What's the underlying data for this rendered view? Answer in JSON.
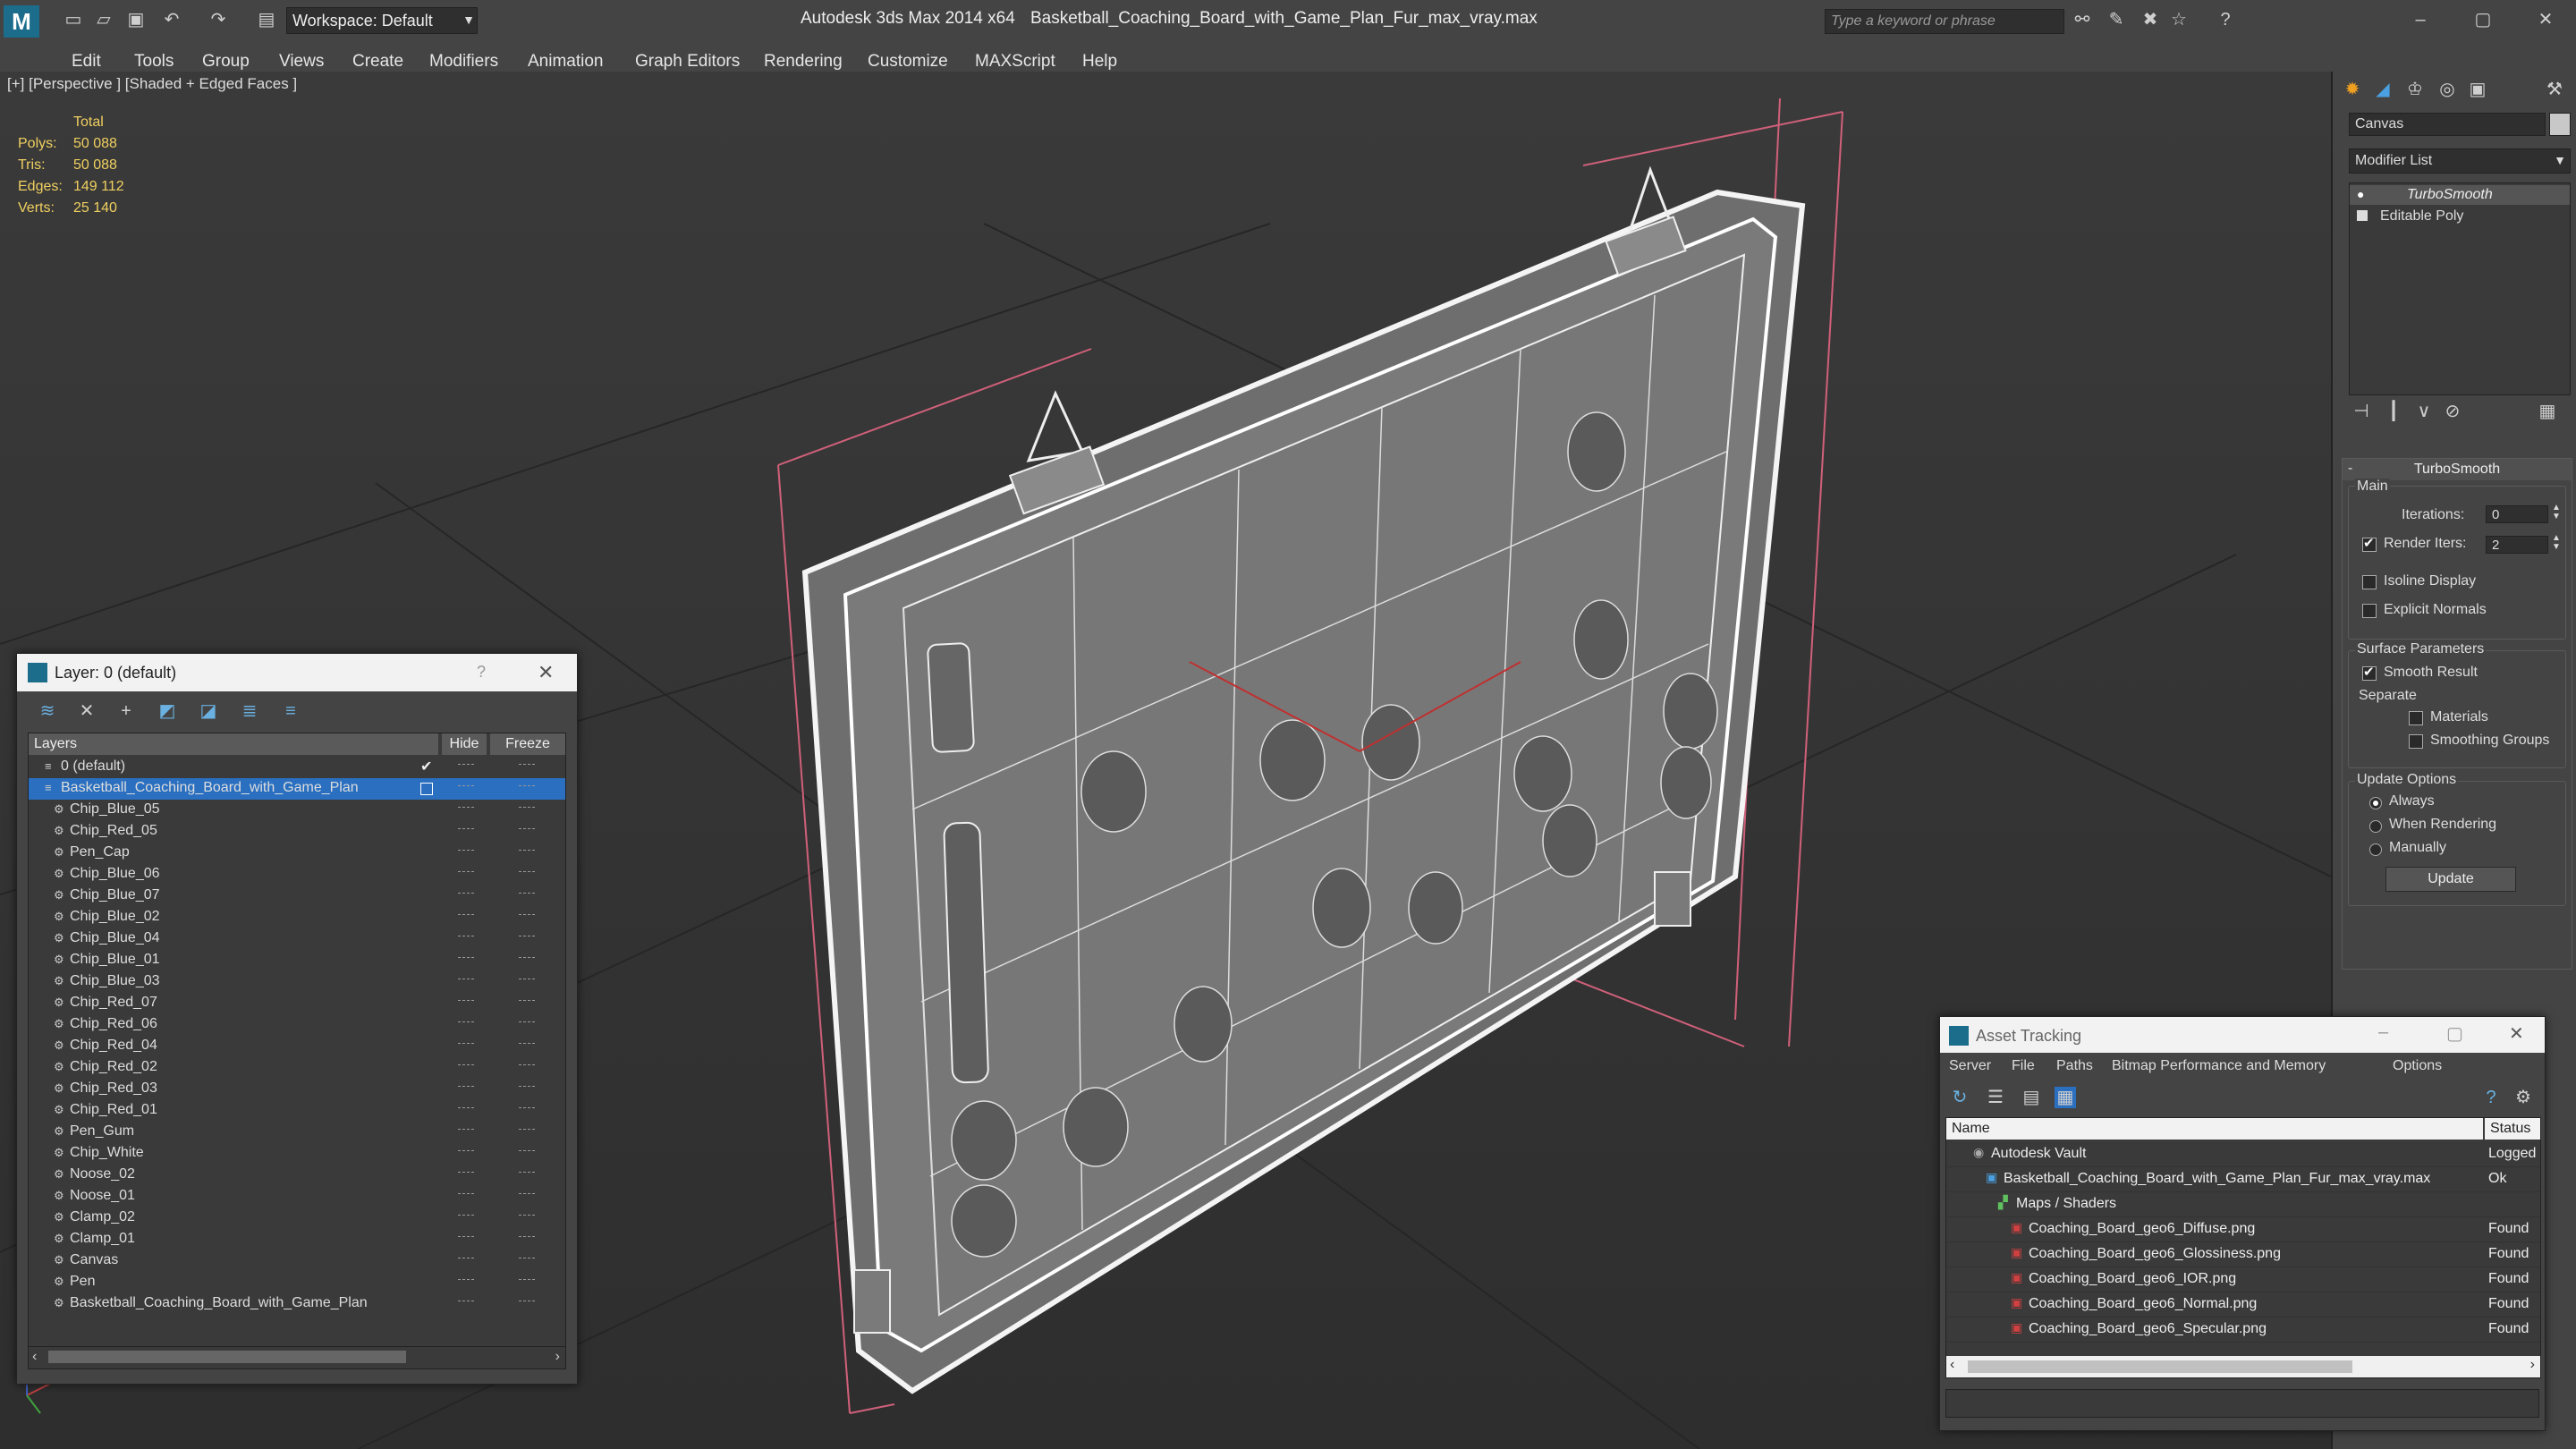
{
  "app": {
    "title": "Autodesk 3ds Max 2014 x64",
    "file": "Basketball_Coaching_Board_with_Game_Plan_Fur_max_vray.max",
    "workspace": "Workspace: Default",
    "search_placeholder": "Type a keyword or phrase"
  },
  "menu": [
    "Edit",
    "Tools",
    "Group",
    "Views",
    "Create",
    "Modifiers",
    "Animation",
    "Graph Editors",
    "Rendering",
    "Customize",
    "MAXScript",
    "Help"
  ],
  "viewport": {
    "label": "[+] [Perspective ] [Shaded + Edged Faces ]",
    "stats": {
      "header": "Total",
      "rows": [
        {
          "label": "Polys:",
          "value": "50 088"
        },
        {
          "label": "Tris:",
          "value": "50 088"
        },
        {
          "label": "Edges:",
          "value": "149 112"
        },
        {
          "label": "Verts:",
          "value": "25 140"
        }
      ]
    }
  },
  "right_panel": {
    "object_name": "Canvas",
    "modifier_list": "Modifier List",
    "stack": [
      "TurboSmooth",
      "Editable Poly"
    ],
    "rollout_title": "TurboSmooth",
    "main_group": "Main",
    "iterations_label": "Iterations:",
    "iterations_value": "0",
    "render_iters_label": "Render Iters:",
    "render_iters_value": "2",
    "isoline": "Isoline Display",
    "explicit": "Explicit Normals",
    "surface_group": "Surface Parameters",
    "smooth_result": "Smooth Result",
    "separate": "Separate",
    "materials": "Materials",
    "smoothing_groups": "Smoothing Groups",
    "update_group": "Update Options",
    "always": "Always",
    "when_rendering": "When Rendering",
    "manually": "Manually",
    "update_btn": "Update"
  },
  "layer_window": {
    "title": "Layer: 0 (default)",
    "help": "?",
    "col_layers": "Layers",
    "col_hide": "Hide",
    "col_freeze": "Freeze",
    "rows": [
      {
        "name": "0 (default)",
        "level": 1
      },
      {
        "name": "Basketball_Coaching_Board_with_Game_Plan",
        "level": 1,
        "selected": true
      },
      {
        "name": "Chip_Blue_05",
        "level": 2
      },
      {
        "name": "Chip_Red_05",
        "level": 2
      },
      {
        "name": "Pen_Cap",
        "level": 2
      },
      {
        "name": "Chip_Blue_06",
        "level": 2
      },
      {
        "name": "Chip_Blue_07",
        "level": 2
      },
      {
        "name": "Chip_Blue_02",
        "level": 2
      },
      {
        "name": "Chip_Blue_04",
        "level": 2
      },
      {
        "name": "Chip_Blue_01",
        "level": 2
      },
      {
        "name": "Chip_Blue_03",
        "level": 2
      },
      {
        "name": "Chip_Red_07",
        "level": 2
      },
      {
        "name": "Chip_Red_06",
        "level": 2
      },
      {
        "name": "Chip_Red_04",
        "level": 2
      },
      {
        "name": "Chip_Red_02",
        "level": 2
      },
      {
        "name": "Chip_Red_03",
        "level": 2
      },
      {
        "name": "Chip_Red_01",
        "level": 2
      },
      {
        "name": "Pen_Gum",
        "level": 2
      },
      {
        "name": "Chip_White",
        "level": 2
      },
      {
        "name": "Noose_02",
        "level": 2
      },
      {
        "name": "Noose_01",
        "level": 2
      },
      {
        "name": "Clamp_02",
        "level": 2
      },
      {
        "name": "Clamp_01",
        "level": 2
      },
      {
        "name": "Canvas",
        "level": 2
      },
      {
        "name": "Pen",
        "level": 2
      },
      {
        "name": "Basketball_Coaching_Board_with_Game_Plan",
        "level": 2
      }
    ]
  },
  "asset_window": {
    "title": "Asset Tracking",
    "menus": [
      "Server",
      "File",
      "Paths",
      "Bitmap Performance and Memory",
      "Options"
    ],
    "col_name": "Name",
    "col_status": "Status",
    "rows": [
      {
        "name": "Autodesk Vault",
        "status": "Logged",
        "level": 1,
        "icon": "vault-icon"
      },
      {
        "name": "Basketball_Coaching_Board_with_Game_Plan_Fur_max_vray.max",
        "status": "Ok",
        "level": 2,
        "icon": "max-file-icon"
      },
      {
        "name": "Maps / Shaders",
        "status": "",
        "level": 3,
        "icon": "maps-icon"
      },
      {
        "name": "Coaching_Board_geo6_Diffuse.png",
        "status": "Found",
        "level": 4,
        "icon": "png-icon"
      },
      {
        "name": "Coaching_Board_geo6_Glossiness.png",
        "status": "Found",
        "level": 4,
        "icon": "png-icon"
      },
      {
        "name": "Coaching_Board_geo6_IOR.png",
        "status": "Found",
        "level": 4,
        "icon": "png-icon"
      },
      {
        "name": "Coaching_Board_geo6_Normal.png",
        "status": "Found",
        "level": 4,
        "icon": "png-icon"
      },
      {
        "name": "Coaching_Board_geo6_Specular.png",
        "status": "Found",
        "level": 4,
        "icon": "png-icon"
      }
    ]
  }
}
